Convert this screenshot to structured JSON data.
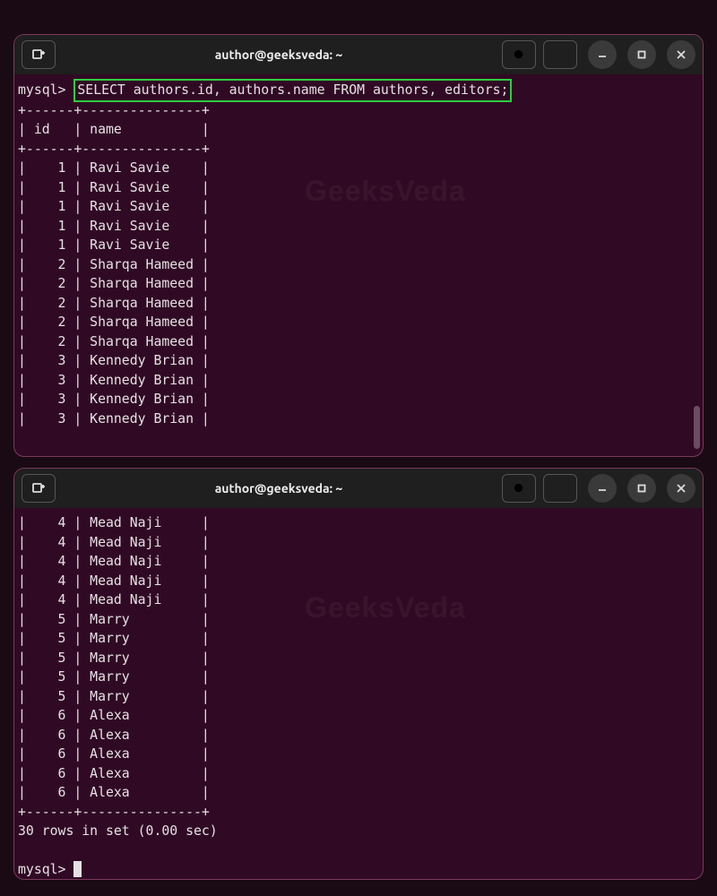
{
  "watermark": "GeeksVeda",
  "window1": {
    "title": "author@geeksveda: ~",
    "prompt": "mysql>",
    "query": "SELECT authors.id, authors.name FROM authors, editors;",
    "separator_top": "+------+---------------+",
    "header_row": "| id   | name          |",
    "separator_mid": "+------+---------------+",
    "rows": [
      "|    1 | Ravi Savie    |",
      "|    1 | Ravi Savie    |",
      "|    1 | Ravi Savie    |",
      "|    1 | Ravi Savie    |",
      "|    1 | Ravi Savie    |",
      "|    2 | Sharqa Hameed |",
      "|    2 | Sharqa Hameed |",
      "|    2 | Sharqa Hameed |",
      "|    2 | Sharqa Hameed |",
      "|    2 | Sharqa Hameed |",
      "|    3 | Kennedy Brian |",
      "|    3 | Kennedy Brian |",
      "|    3 | Kennedy Brian |",
      "|    3 | Kennedy Brian |"
    ]
  },
  "window2": {
    "title": "author@geeksveda: ~",
    "prompt": "mysql>",
    "rows": [
      "|    4 | Mead Naji     |",
      "|    4 | Mead Naji     |",
      "|    4 | Mead Naji     |",
      "|    4 | Mead Naji     |",
      "|    4 | Mead Naji     |",
      "|    5 | Marry         |",
      "|    5 | Marry         |",
      "|    5 | Marry         |",
      "|    5 | Marry         |",
      "|    5 | Marry         |",
      "|    6 | Alexa         |",
      "|    6 | Alexa         |",
      "|    6 | Alexa         |",
      "|    6 | Alexa         |",
      "|    6 | Alexa         |"
    ],
    "separator_bottom": "+------+---------------+",
    "summary": "30 rows in set (0.00 sec)"
  }
}
